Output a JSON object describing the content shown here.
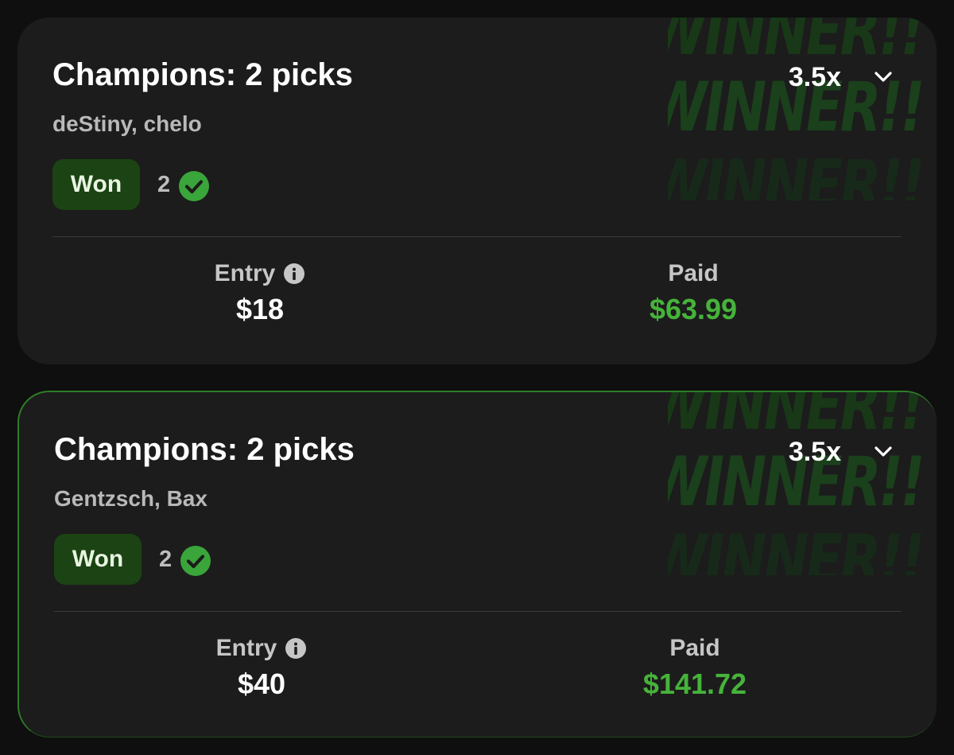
{
  "colors": {
    "background": "#0f0f0f",
    "card": "#1c1c1c",
    "won_badge_bg": "#1b4313",
    "check_green": "#3aa53a",
    "paid_green": "#46b33a",
    "watermark": "#1b401c"
  },
  "cards": [
    {
      "title": "Champions: 2 picks",
      "multiplier": "3.5x",
      "players": "deStiny, chelo",
      "status": "Won",
      "correct_count": "2",
      "watermark_text": "WINNER!!",
      "entry_label": "Entry",
      "entry_value": "$18",
      "paid_label": "Paid",
      "paid_value": "$63.99"
    },
    {
      "title": "Champions: 2 picks",
      "multiplier": "3.5x",
      "players": "Gentzsch, Bax",
      "status": "Won",
      "correct_count": "2",
      "watermark_text": "WINNER!!",
      "entry_label": "Entry",
      "entry_value": "$40",
      "paid_label": "Paid",
      "paid_value": "$141.72"
    }
  ],
  "icons": {
    "chevron": "chevron-down-icon",
    "check": "check-circle-icon",
    "info": "info-icon"
  }
}
